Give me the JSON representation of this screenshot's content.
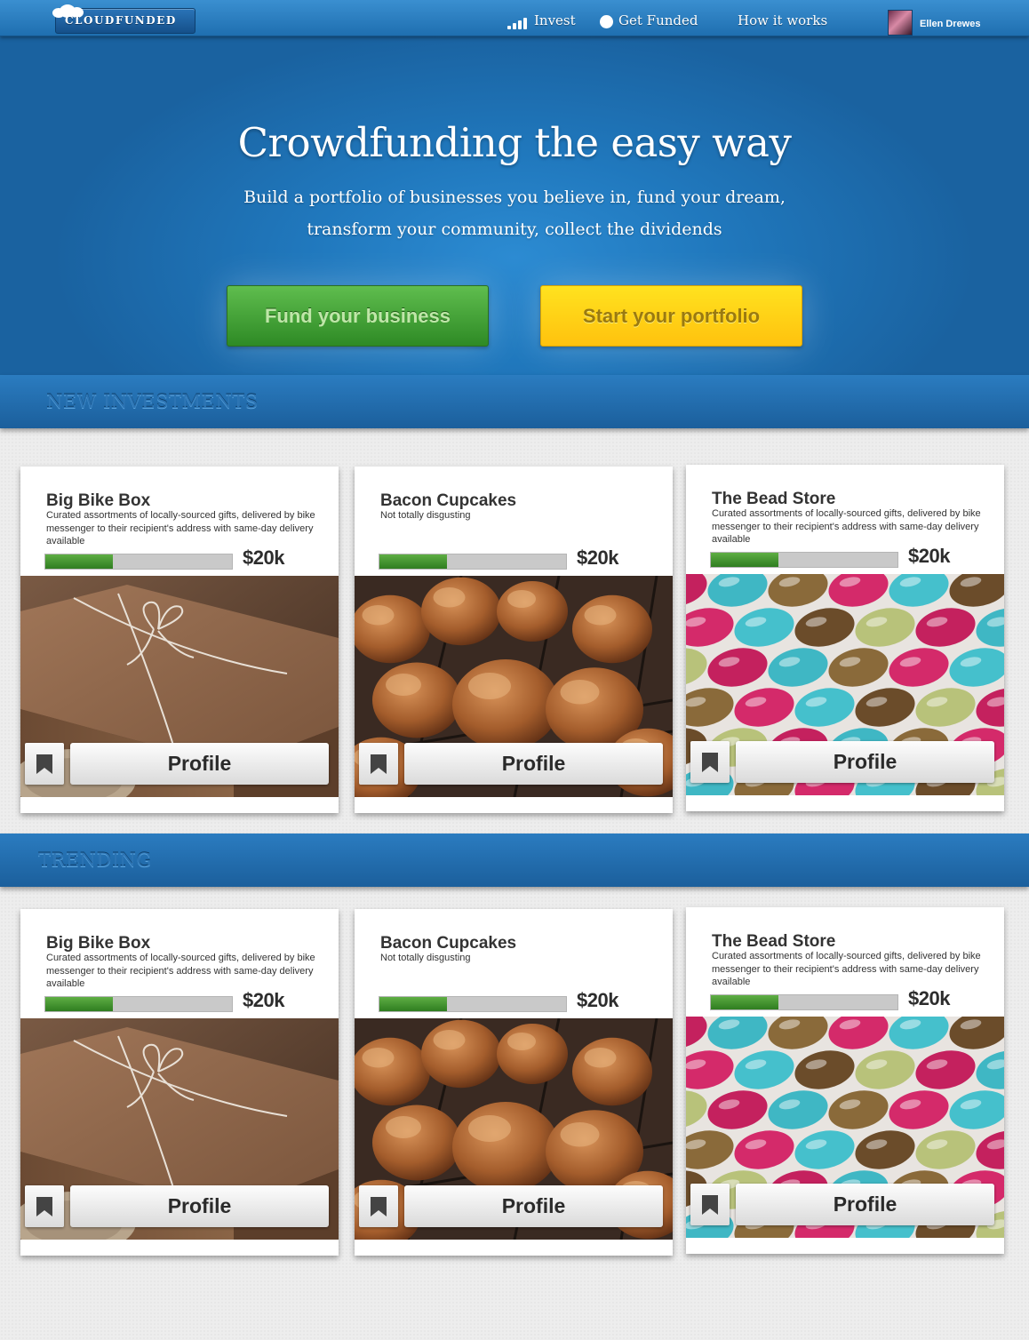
{
  "nav": {
    "logo_text": "CLOUDFUNDED",
    "invest": "Invest",
    "get_funded": "Get Funded",
    "how_it_works": "How it works",
    "user_name": "Ellen Drewes"
  },
  "hero": {
    "title": "Crowdfunding the easy way",
    "subtitle_line1": "Build a portfolio of businesses you believe in, fund your dream,",
    "subtitle_line2": "transform your community, collect the dividends",
    "fund_button": "Fund your business",
    "portfolio_button": "Start your portfolio"
  },
  "colors": {
    "brand_blue": "#1f6fb0",
    "green_button": "#2e8a25",
    "yellow_button": "#ffc20e",
    "progress_green": "#2f7d20"
  },
  "sections": [
    {
      "title": "NEW INVESTMENTS",
      "cards": [
        {
          "name": "Big Bike Box",
          "desc": "Curated assortments of locally-sourced gifts, delivered by bike messenger to their recipient's address with same-day delivery available",
          "amount": "$20k",
          "progress": 0.36,
          "image": "gift-box-photo",
          "profile": "Profile"
        },
        {
          "name": "Bacon Cupcakes",
          "desc": "Not totally disgusting",
          "amount": "$20k",
          "progress": 0.36,
          "image": "cupcakes-photo",
          "profile": "Profile"
        },
        {
          "name": "The Bead Store",
          "desc": "Curated assortments of locally-sourced gifts, delivered by bike messenger to their recipient's address with same-day delivery available",
          "amount": "$20k",
          "progress": 0.36,
          "image": "beads-photo",
          "profile": "Profile"
        }
      ]
    },
    {
      "title": "TRENDING",
      "cards": [
        {
          "name": "Big Bike Box",
          "desc": "Curated assortments of locally-sourced gifts, delivered by bike messenger to their recipient's address with same-day delivery available",
          "amount": "$20k",
          "progress": 0.36,
          "image": "gift-box-photo",
          "profile": "Profile"
        },
        {
          "name": "Bacon Cupcakes",
          "desc": "Not totally disgusting",
          "amount": "$20k",
          "progress": 0.36,
          "image": "cupcakes-photo",
          "profile": "Profile"
        },
        {
          "name": "The Bead Store",
          "desc": "Curated assortments of locally-sourced gifts, delivered by bike messenger to their recipient's address with same-day delivery available",
          "amount": "$20k",
          "progress": 0.36,
          "image": "beads-photo",
          "profile": "Profile"
        }
      ]
    }
  ]
}
